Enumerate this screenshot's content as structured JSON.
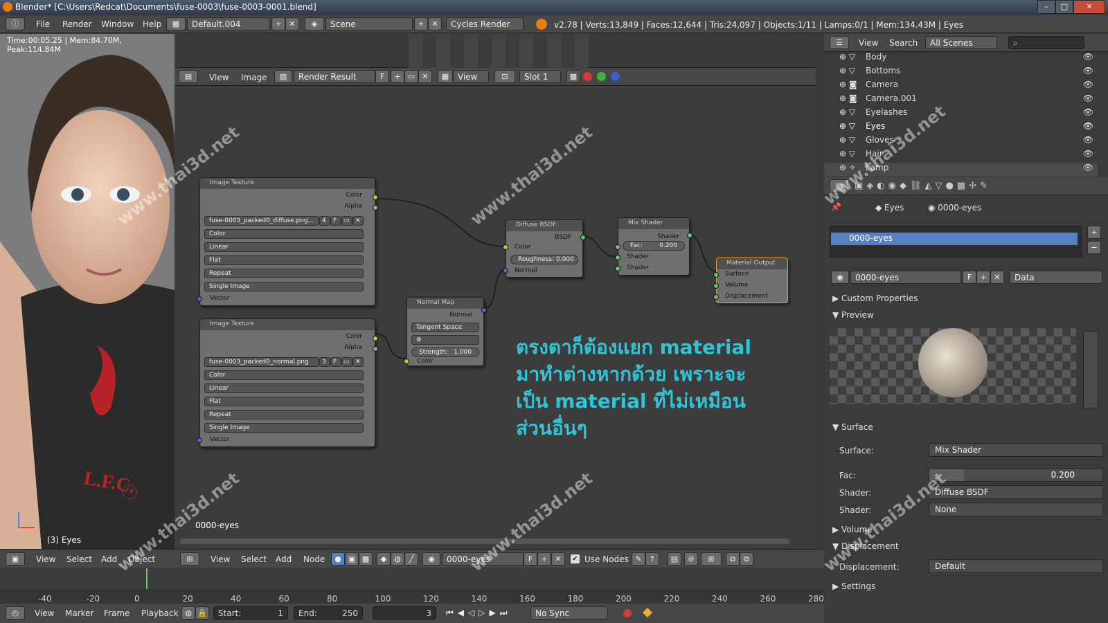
{
  "window": {
    "title": "Blender* [C:\\Users\\Redcat\\Documents\\fuse-0003\\fuse-0003-0001.blend]"
  },
  "infobar": {
    "menus": [
      "File",
      "Render",
      "Window",
      "Help"
    ],
    "layout": "Default.004",
    "scene": "Scene",
    "engine": "Cycles Render",
    "stats": "v2.78 | Verts:13,849 | Faces:12,644 | Tris:24,097 | Objects:1/11 | Lamps:0/1 | Mem:134.43M | Eyes"
  },
  "viewport": {
    "render_info": "Time:00:05.25 | Mem:84.70M, Peak:114.84M",
    "object_label": "(3) Eyes",
    "menus": [
      "View",
      "Select",
      "Add",
      "Object"
    ]
  },
  "image_editor": {
    "menus": [
      "View",
      "Image"
    ],
    "image": "Render Result",
    "f": "F",
    "view": "View",
    "slot": "Slot 1"
  },
  "nodes": {
    "tex1": {
      "title": "Image Texture",
      "out_color": "Color",
      "out_alpha": "Alpha",
      "file": "fuse-0003_packed0_diffuse.png...",
      "users": "4",
      "f": "F",
      "color": "Color",
      "interp": "Linear",
      "proj": "Flat",
      "ext": "Repeat",
      "src": "Single Image",
      "vector": "Vector"
    },
    "tex2": {
      "title": "Image Texture",
      "out_color": "Color",
      "out_alpha": "Alpha",
      "file": "fuse-0003_packed0_normal.png",
      "users": "3",
      "f": "F",
      "color": "Color",
      "interp": "Linear",
      "proj": "Flat",
      "ext": "Repeat",
      "src": "Single Image",
      "vector": "Vector"
    },
    "normal": {
      "title": "Normal Map",
      "out": "Normal",
      "space": "Tangent Space",
      "strength": "Strength:",
      "strength_val": "1.000",
      "color": "Color"
    },
    "diffuse": {
      "title": "Diffuse BSDF",
      "out": "BSDF",
      "color": "Color",
      "roughness": "Roughness:",
      "roughness_val": "0.000",
      "normal": "Normal"
    },
    "mix": {
      "title": "Mix Shader",
      "out": "Shader",
      "fac": "Fac:",
      "fac_val": "0.200",
      "shader1": "Shader",
      "shader2": "Shader"
    },
    "output": {
      "title": "Material Output",
      "surface": "Surface",
      "volume": "Volume",
      "displacement": "Displacement"
    }
  },
  "node_editor": {
    "material_label": "0000-eyes",
    "menus": [
      "View",
      "Select",
      "Add",
      "Node"
    ],
    "material": "0000-eyes",
    "f": "F",
    "use_nodes": "Use Nodes"
  },
  "annotation": {
    "lines": [
      "ตรงตาก็ต้องแยก material",
      "มาทำต่างหากด้วย เพราะจะ",
      "เป็น material ที่ไม่เหมือน",
      "ส่วนอื่นๆ"
    ]
  },
  "outliner": {
    "menus": [
      "View",
      "Search"
    ],
    "filter": "All Scenes",
    "items": [
      "Body",
      "Bottoms",
      "Camera",
      "Camera.001",
      "Eyelashes",
      "Eyes",
      "Gloves",
      "Hair",
      "Lamp"
    ]
  },
  "properties": {
    "breadcrumb_obj": "Eyes",
    "breadcrumb_mat": "0000-eyes",
    "slot": "0000-eyes",
    "material": "0000-eyes",
    "f": "F",
    "link": "Data",
    "panels": {
      "custom": "Custom Properties",
      "preview": "Preview",
      "surface": "Surface",
      "volume": "Volume",
      "displacement": "Displacement",
      "settings": "Settings"
    },
    "surface_label": "Surface:",
    "surface_val": "Mix Shader",
    "fac_label": "Fac:",
    "fac_val": "0.200",
    "fac_fraction": 0.2,
    "shader1_label": "Shader:",
    "shader1_val": "Diffuse BSDF",
    "shader2_label": "Shader:",
    "shader2_val": "None",
    "disp_label": "Displacement:",
    "disp_val": "Default"
  },
  "timeline": {
    "ticks": [
      "-40",
      "-20",
      "0",
      "20",
      "40",
      "60",
      "80",
      "100",
      "120",
      "140",
      "160",
      "180",
      "200",
      "220",
      "240",
      "260",
      "280"
    ],
    "menus": [
      "View",
      "Marker",
      "Frame",
      "Playback"
    ],
    "start": "Start:",
    "start_val": "1",
    "end": "End:",
    "end_val": "250",
    "current": "3",
    "sync": "No Sync"
  },
  "watermark": "www.thai3d.net"
}
